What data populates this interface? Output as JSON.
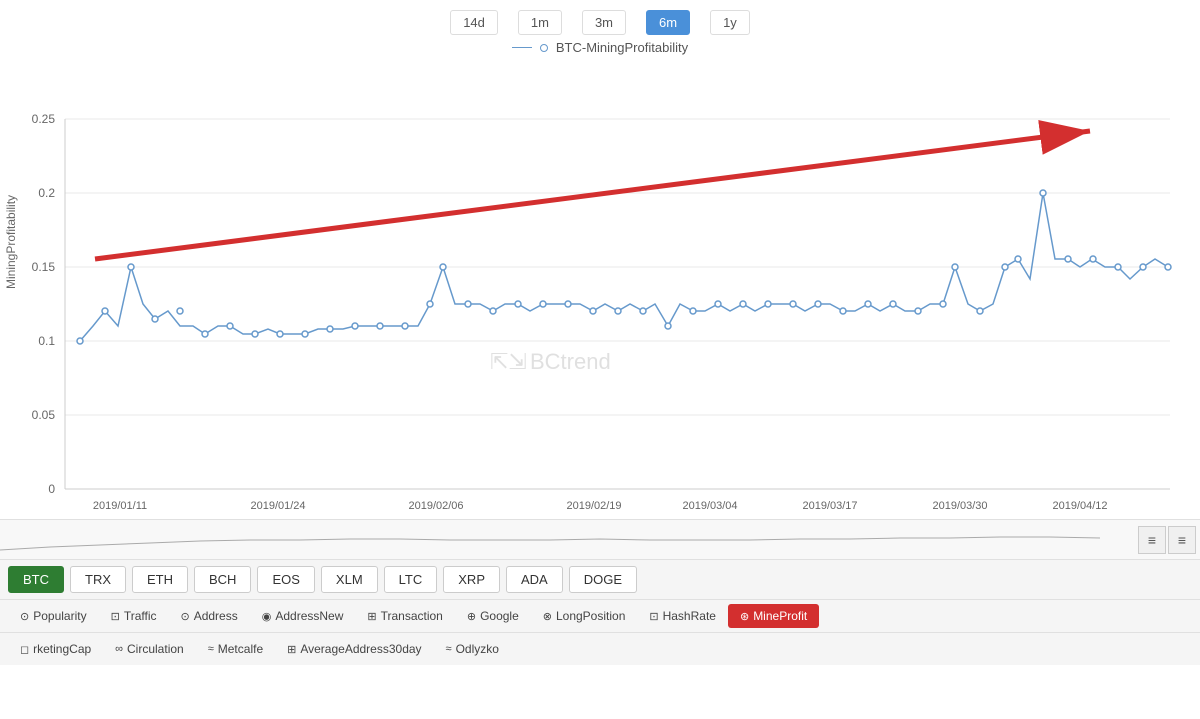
{
  "timeRange": {
    "buttons": [
      "14d",
      "1m",
      "3m",
      "6m",
      "1y"
    ],
    "active": "6m"
  },
  "legend": {
    "label": "BTC-MiningProfitability"
  },
  "yAxis": {
    "label": "MiningProfitability",
    "ticks": [
      "0",
      "0.05",
      "0.1",
      "0.15",
      "0.2",
      "0.25"
    ]
  },
  "xAxis": {
    "ticks": [
      "2019/01/11",
      "2019/01/24",
      "2019/02/06",
      "2019/02/19",
      "2019/03/04",
      "2019/03/17",
      "2019/03/30",
      "2019/04/12"
    ]
  },
  "watermark": "BCtrend",
  "coins": {
    "items": [
      "BTC",
      "TRX",
      "ETH",
      "BCH",
      "EOS",
      "XLM",
      "LTC",
      "XRP",
      "ADA",
      "DOGE"
    ],
    "active": "BTC"
  },
  "metrics": {
    "items": [
      {
        "icon": "⊙",
        "label": "Popularity"
      },
      {
        "icon": "⊡",
        "label": "Traffic"
      },
      {
        "icon": "⊙",
        "label": "Address"
      },
      {
        "icon": "◉",
        "label": "AddressNew"
      },
      {
        "icon": "⊞",
        "label": "Transaction"
      },
      {
        "icon": "⊕",
        "label": "Google"
      },
      {
        "icon": "⊗",
        "label": "LongPosition"
      },
      {
        "icon": "⊡",
        "label": "HashRate"
      },
      {
        "icon": "⊛",
        "label": "MineProfit"
      }
    ],
    "active": "MineProfit"
  },
  "bottomTabs": {
    "items": [
      {
        "icon": "◻",
        "label": "rketingCap"
      },
      {
        "icon": "∞",
        "label": "Circulation"
      },
      {
        "icon": "≈",
        "label": "Metcalfe"
      },
      {
        "icon": "⊞",
        "label": "AverageAddress30day"
      },
      {
        "icon": "≈",
        "label": "Odlyzko"
      }
    ]
  },
  "navIcons": [
    "≡",
    "≡"
  ]
}
